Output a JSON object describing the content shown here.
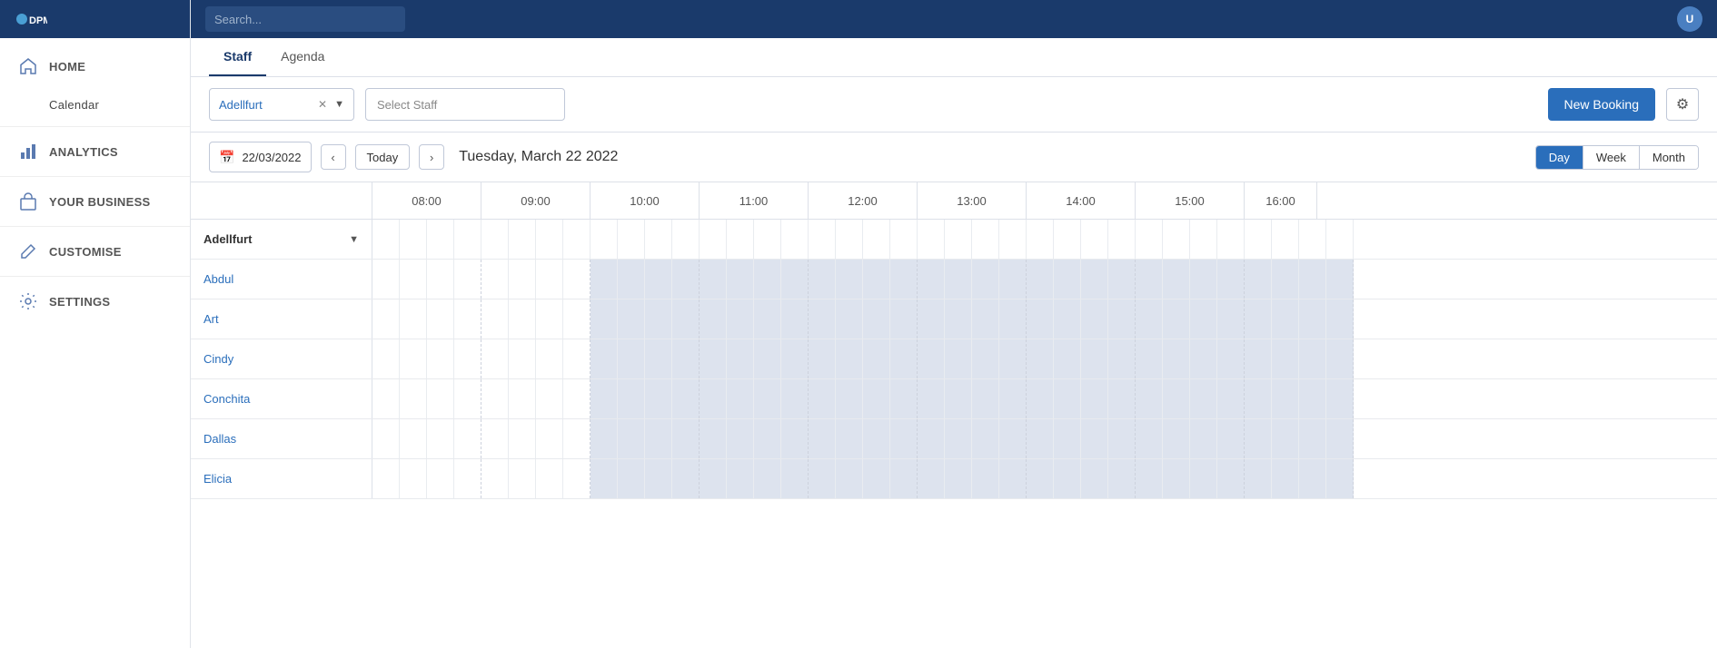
{
  "app": {
    "title": "DPM"
  },
  "sidebar": {
    "nav_items": [
      {
        "id": "home",
        "label": "HOME",
        "icon": "home-icon"
      },
      {
        "id": "calendar",
        "label": "Calendar",
        "icon": null,
        "sub": true
      },
      {
        "id": "analytics",
        "label": "ANALYTICS",
        "icon": "analytics-icon"
      },
      {
        "id": "your_business",
        "label": "YOUR BUSINESS",
        "icon": "business-icon"
      },
      {
        "id": "customise",
        "label": "CUSTOMISE",
        "icon": "edit-icon"
      },
      {
        "id": "settings",
        "label": "SETTINGS",
        "icon": "settings-icon"
      }
    ]
  },
  "topbar": {
    "search_placeholder": "Search..."
  },
  "tabs": [
    {
      "id": "staff",
      "label": "Staff",
      "active": true
    },
    {
      "id": "agenda",
      "label": "Agenda",
      "active": false
    }
  ],
  "toolbar": {
    "location_value": "Adellfurt",
    "select_staff_placeholder": "Select Staff",
    "new_booking_label": "New Booking",
    "settings_icon": "⚙"
  },
  "date_nav": {
    "date_value": "22/03/2022",
    "today_label": "Today",
    "date_title": "Tuesday, March 22 2022",
    "view_buttons": [
      {
        "id": "day",
        "label": "Day",
        "active": true
      },
      {
        "id": "week",
        "label": "Week",
        "active": false
      },
      {
        "id": "month",
        "label": "Month",
        "active": false
      }
    ]
  },
  "calendar": {
    "time_headers": [
      "08:00",
      "09:00",
      "10:00",
      "11:00",
      "12:00",
      "13:00",
      "14:00",
      "15:00",
      "16:00"
    ],
    "group_header": "Adellfurt",
    "staff_members": [
      {
        "id": "abdul",
        "name": "Abdul"
      },
      {
        "id": "art",
        "name": "Art"
      },
      {
        "id": "cindy",
        "name": "Cindy"
      },
      {
        "id": "conchita",
        "name": "Conchita"
      },
      {
        "id": "dallas",
        "name": "Dallas"
      },
      {
        "id": "elicia",
        "name": "Elicia"
      }
    ]
  }
}
